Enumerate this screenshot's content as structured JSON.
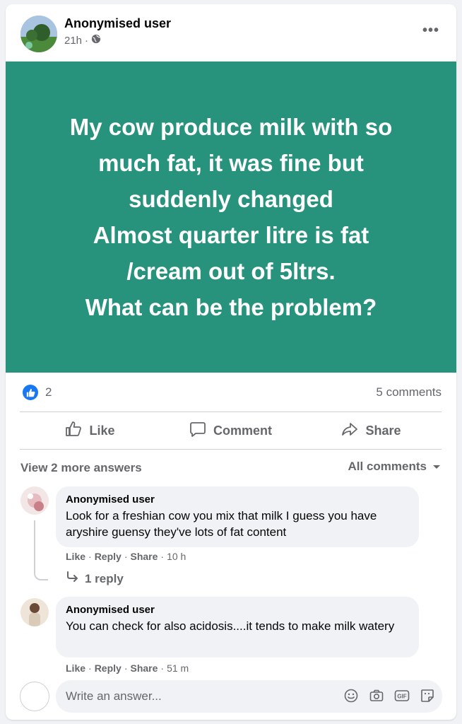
{
  "post": {
    "author": "Anonymised user",
    "time": "21h",
    "separator": "·",
    "banner_text": "My cow produce milk with so\nmuch fat, it was fine but\nsuddenly changed\nAlmost quarter litre is fat\n/cream out of 5ltrs.\nWhat can be the problem?",
    "banner_color": "#27937d"
  },
  "stats": {
    "likes": "2",
    "comments": "5 comments"
  },
  "actions": {
    "like": "Like",
    "comment": "Comment",
    "share": "Share"
  },
  "comments_header": {
    "view_more": "View 2 more answers",
    "sort": "All comments"
  },
  "comments": [
    {
      "name": "Anonymised user",
      "text": "Look for a freshian cow you mix that milk I guess you have aryshire guensy they've lots of fat content",
      "like": "Like",
      "reply": "Reply",
      "share": "Share",
      "time": "10 h",
      "replies": "1 reply"
    },
    {
      "name": "Anonymised user",
      "text": "You can check for also acidosis....it tends to make milk watery",
      "like": "Like",
      "reply": "Reply",
      "share": "Share",
      "time": "51 m"
    }
  ],
  "composer": {
    "placeholder": "Write an answer..."
  },
  "icons": [
    "globe-icon",
    "more-icon",
    "like-badge-icon",
    "like-icon",
    "comment-icon",
    "share-icon",
    "caret-down-icon",
    "reply-arrow-icon",
    "emoji-icon",
    "camera-icon",
    "gif-icon",
    "sticker-icon"
  ],
  "colors": {
    "accent": "#1877f2",
    "secondary_text": "#65676b",
    "bubble": "#f0f2f5"
  }
}
